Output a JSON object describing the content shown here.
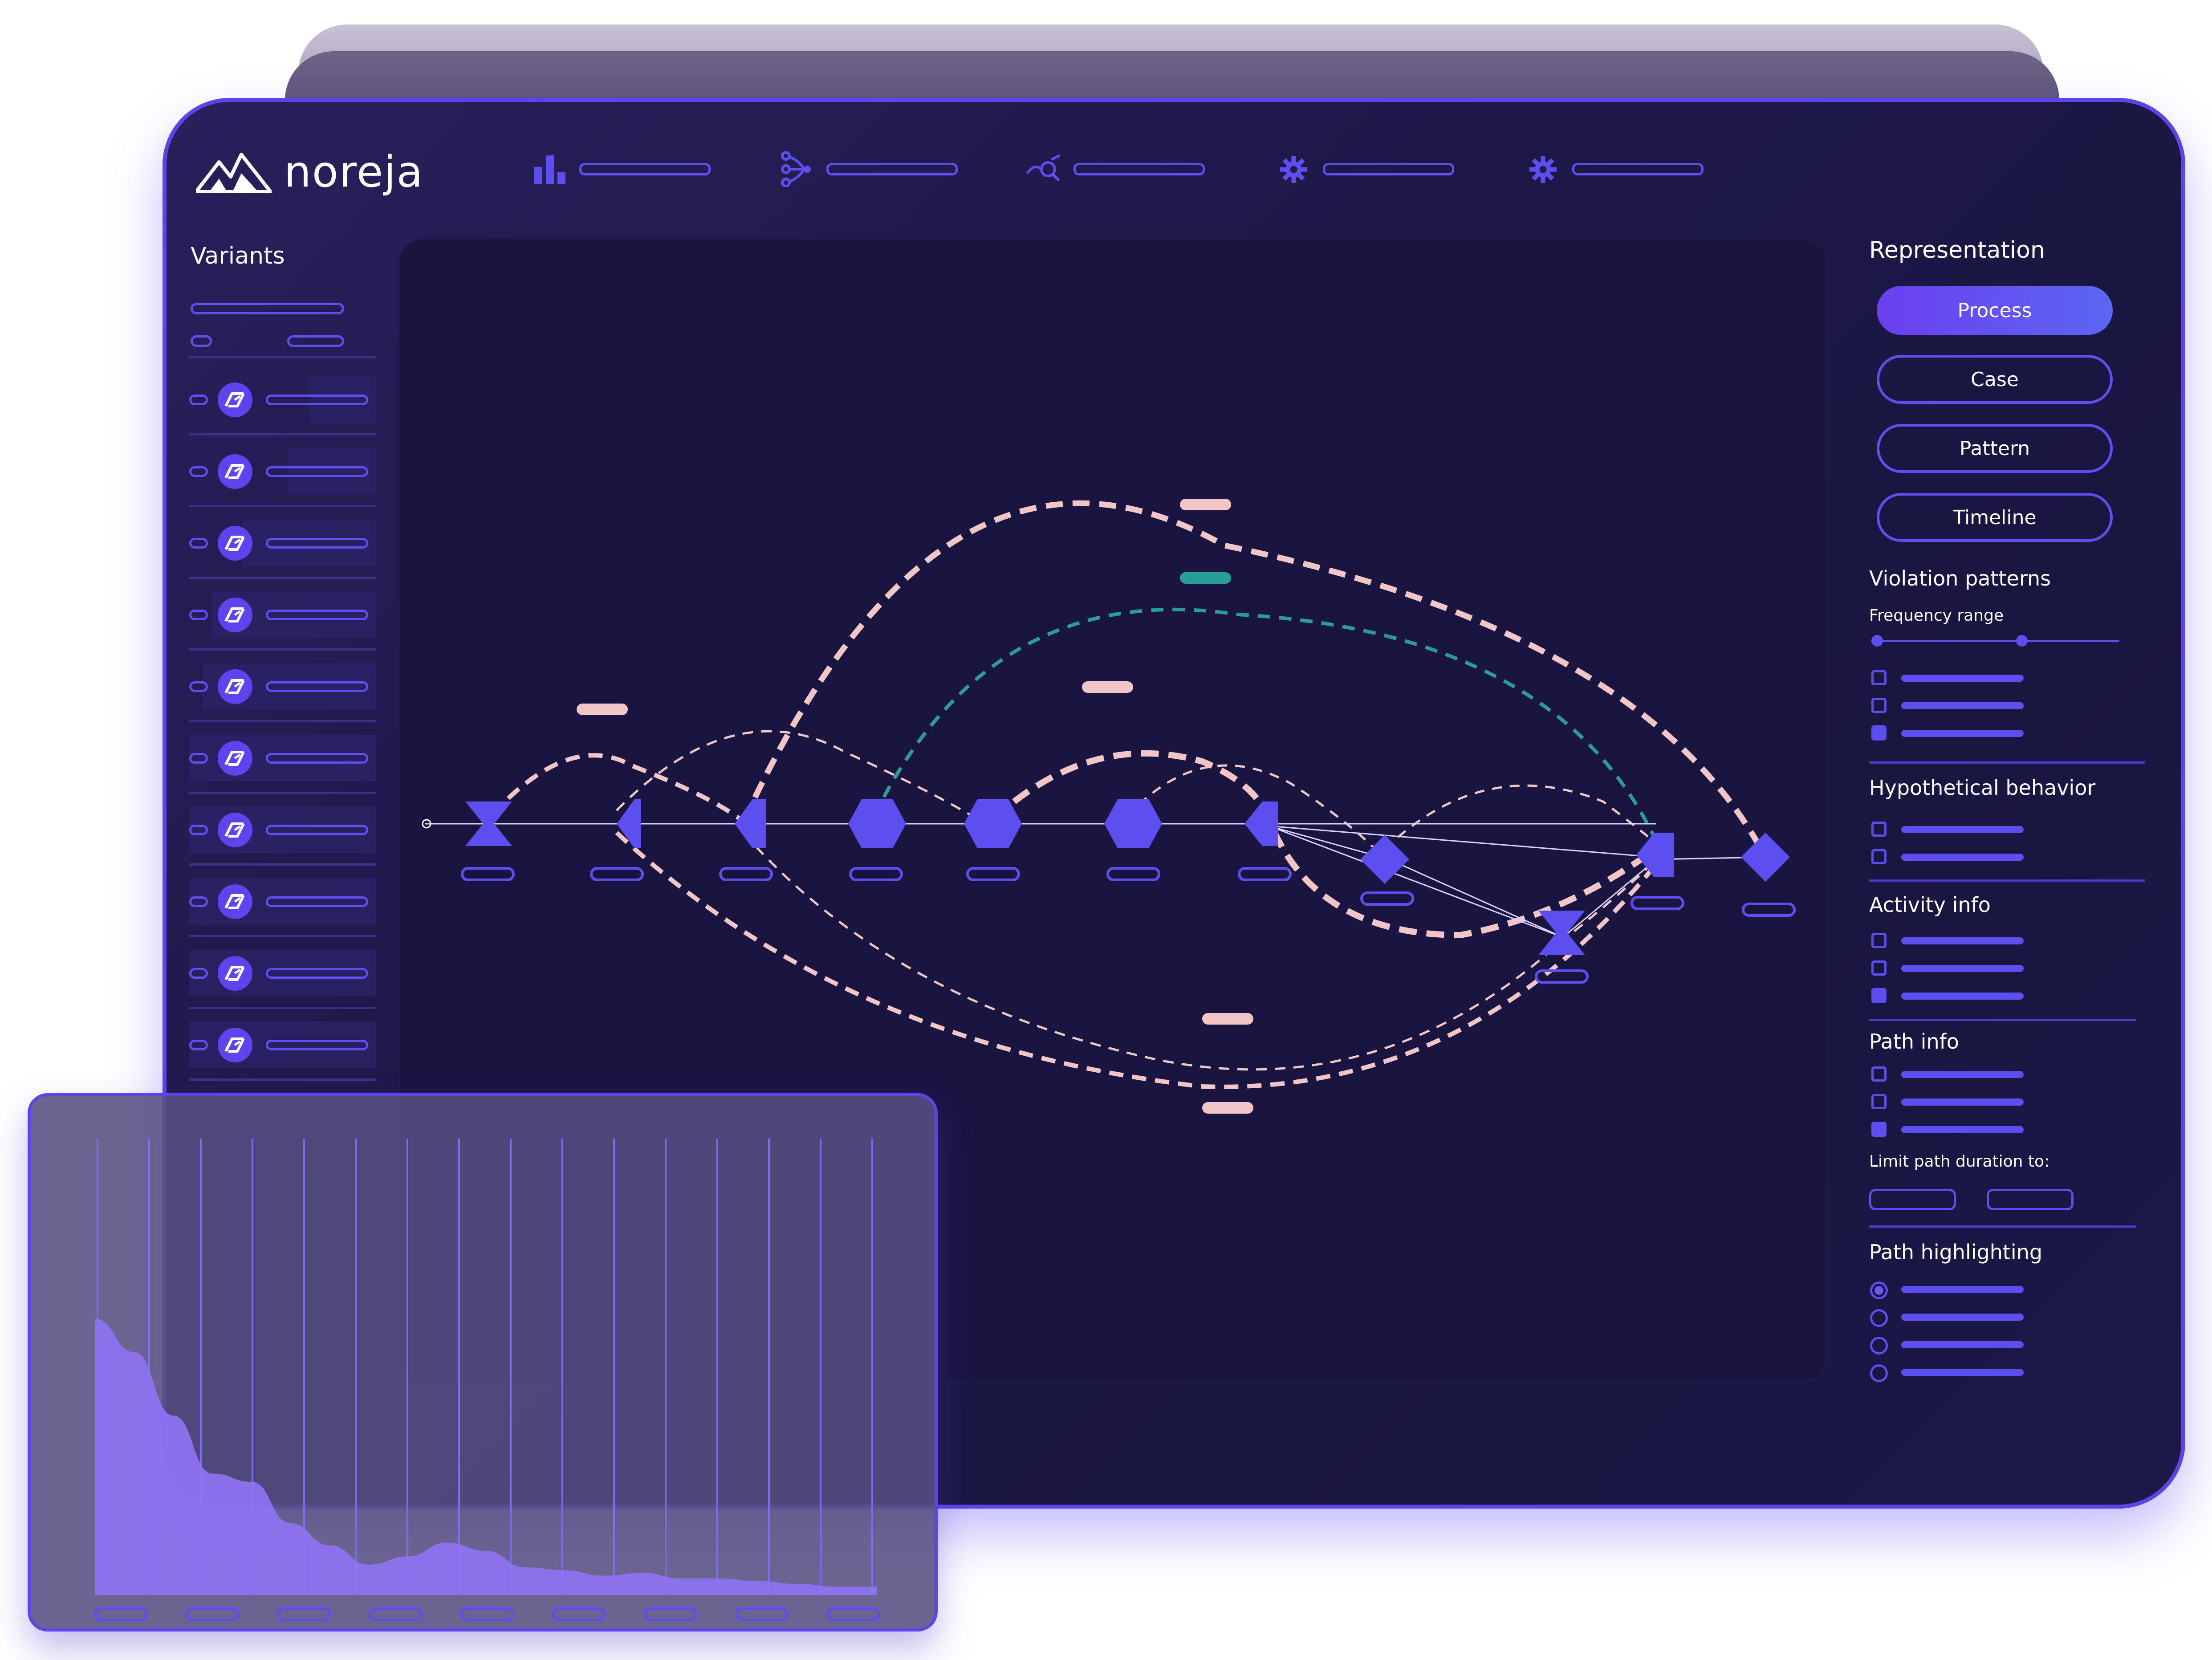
{
  "app": {
    "name": "noreja"
  },
  "nav": [
    {
      "icon": "bar-chart-icon"
    },
    {
      "icon": "branch-icon"
    },
    {
      "icon": "search-trend-icon"
    },
    {
      "icon": "gear-icon"
    },
    {
      "icon": "gear-icon"
    }
  ],
  "sidebar": {
    "title": "Variants",
    "variant_count": 10,
    "icon": "variant-icon"
  },
  "representation": {
    "title": "Representation",
    "options": [
      "Process",
      "Case",
      "Pattern",
      "Timeline"
    ],
    "selected": "Process"
  },
  "violation_patterns": {
    "title": "Violation patterns",
    "frequency_label": "Frequency range",
    "checkboxes": [
      false,
      false,
      true
    ]
  },
  "hypothetical_behavior": {
    "title": "Hypothetical behavior",
    "checkboxes": [
      false,
      false
    ]
  },
  "activity_info": {
    "title": "Activity info",
    "checkboxes": [
      false,
      false,
      true
    ]
  },
  "path_info": {
    "title": "Path info",
    "checkboxes": [
      false,
      false,
      true
    ],
    "limit_label": "Limit path duration to:"
  },
  "path_highlighting": {
    "title": "Path highlighting",
    "radios": [
      true,
      false,
      false,
      false
    ]
  },
  "colors": {
    "accent": "#5d4ef0",
    "dashed_pink": "#f2c6c6",
    "dashed_teal": "#2a9d99",
    "node": "#5d4ef0"
  },
  "chart_data": {
    "type": "area",
    "x": [
      0,
      1,
      2,
      3,
      4,
      5,
      6,
      7,
      8,
      9,
      10,
      11,
      12,
      13,
      14,
      15,
      16,
      17,
      18,
      19,
      20
    ],
    "values": [
      100,
      88,
      65,
      44,
      41,
      26,
      18,
      11,
      14,
      19,
      16,
      10,
      9,
      7,
      8,
      6,
      6,
      5,
      4,
      3,
      3
    ],
    "x_tick_count": 9,
    "vertical_grid_lines": 16
  }
}
